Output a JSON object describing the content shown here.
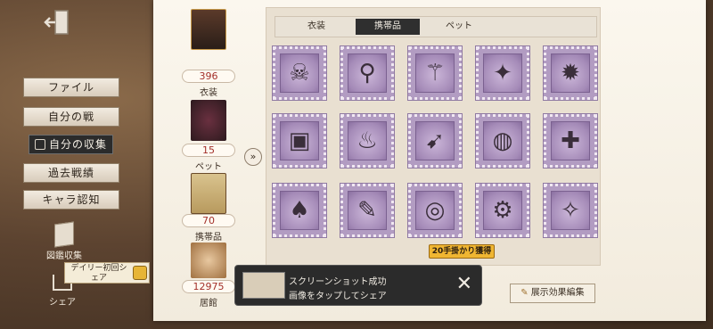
{
  "sidebar": {
    "items": [
      {
        "label": "ファイル"
      },
      {
        "label": "自分の戦"
      },
      {
        "label": "自分の収集"
      },
      {
        "label": "過去戦績"
      },
      {
        "label": "キャラ認知"
      }
    ],
    "catalog_label": "図鑑収集",
    "share_label": "シェア",
    "daily_tip": "デイリー初回シェア"
  },
  "stats": [
    {
      "value": "396",
      "label": "衣装"
    },
    {
      "value": "15",
      "label": "ペット"
    },
    {
      "value": "70",
      "label": "携帯品"
    },
    {
      "value": "12975",
      "label": "居館"
    }
  ],
  "tabs": [
    {
      "label": "衣装"
    },
    {
      "label": "携帯品"
    },
    {
      "label": "ペット"
    }
  ],
  "items": [
    {
      "icon": "skull-trinket-icon"
    },
    {
      "icon": "key-staff-icon"
    },
    {
      "icon": "crow-icon"
    },
    {
      "icon": "spear-icon"
    },
    {
      "icon": "golden-relic-icon"
    },
    {
      "icon": "portrait-card-icon"
    },
    {
      "icon": "candle-stand-icon"
    },
    {
      "icon": "purple-needle-icon"
    },
    {
      "icon": "pumpkin-lantern-icon"
    },
    {
      "icon": "crossbow-icon"
    },
    {
      "icon": "hat-cape-icon"
    },
    {
      "icon": "golden-rod-icon"
    },
    {
      "icon": "target-disc-icon"
    },
    {
      "icon": "gear-box-icon"
    },
    {
      "icon": "blue-orb-staff-icon"
    }
  ],
  "toast": {
    "line1": "スクリーンショット成功",
    "line2": "画像をタップしてシェア",
    "close": "✕"
  },
  "reward_tag": "20手掛かり獲得",
  "edit_button": "展示効果編集",
  "colors": {
    "accent_red": "#a3302a",
    "stamp_purple": "#b29cc2",
    "reward_gold": "#f0b632"
  }
}
